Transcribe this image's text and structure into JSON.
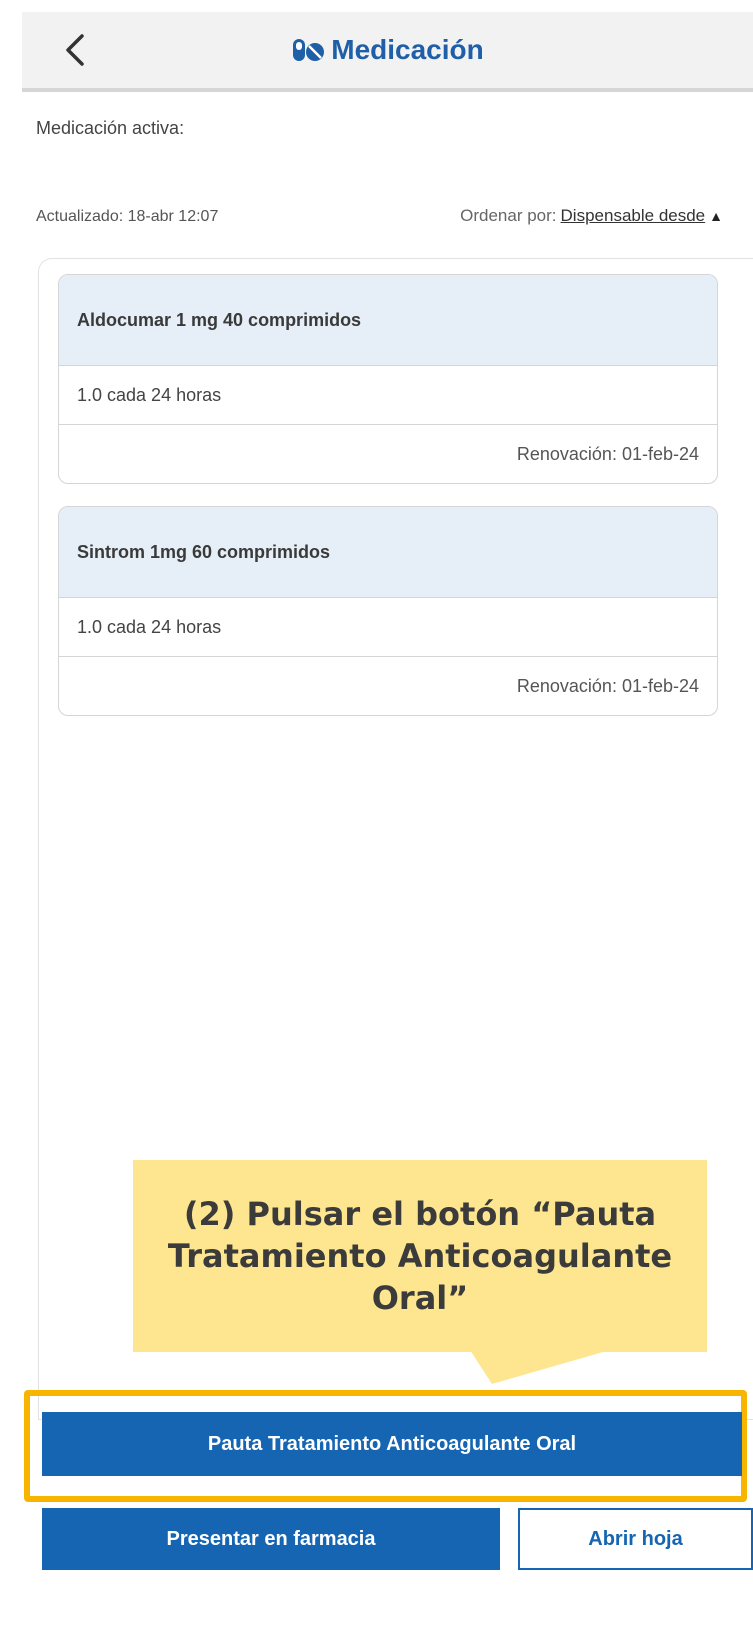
{
  "header": {
    "title": "Medicación"
  },
  "list": {
    "active_label": "Medicación activa:",
    "updated": "Actualizado: 18-abr 12:07",
    "sort_prefix": "Ordenar por:",
    "sort_value": "Dispensable desde"
  },
  "medications": [
    {
      "name": "Aldocumar 1 mg 40 comprimidos",
      "dose": "1.0 cada 24 horas",
      "renewal": "Renovación: 01-feb-24"
    },
    {
      "name": "Sintrom 1mg 60 comprimidos",
      "dose": "1.0 cada 24 horas",
      "renewal": "Renovación: 01-feb-24"
    }
  ],
  "callout": {
    "text": "(2) Pulsar el botón “Pauta Tratamiento Anticoagulante Oral”"
  },
  "actions": {
    "primary_label": "Pauta Tratamiento Anticoagulante Oral",
    "pharmacy_label": "Presentar en farmacia",
    "open_label": "Abrir hoja"
  },
  "colors": {
    "accent": "#1565b3",
    "title": "#1f5fa8",
    "callout": "#fde68f",
    "highlight": "#f7b500",
    "card_header": "#e6eef7"
  },
  "icons": [
    "back-chevron-icon",
    "pills-icon",
    "sort-ascending-icon"
  ]
}
